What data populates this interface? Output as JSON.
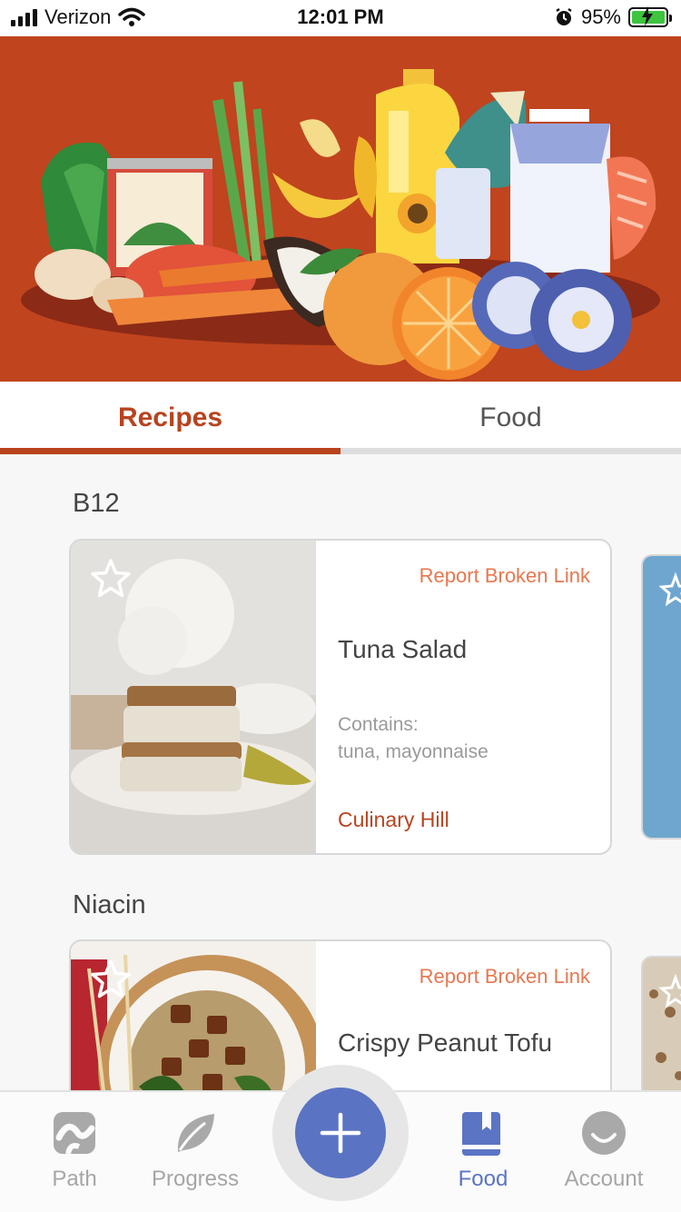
{
  "status_bar": {
    "carrier": "Verizon",
    "time": "12:01 PM",
    "battery": "95%"
  },
  "tabs": [
    {
      "label": "Recipes",
      "active": true
    },
    {
      "label": "Food",
      "active": false
    }
  ],
  "sections": [
    {
      "title": "B12",
      "card": {
        "report_label": "Report Broken Link",
        "name": "Tuna Salad",
        "contains_label": "Contains:",
        "contains": "tuna, mayonnaise",
        "source": "Culinary Hill"
      }
    },
    {
      "title": "Niacin",
      "card": {
        "report_label": "Report Broken Link",
        "name": "Crispy Peanut Tofu"
      }
    }
  ],
  "bottom_nav": {
    "path": "Path",
    "progress": "Progress",
    "food": "Food",
    "account": "Account",
    "active": "Food"
  },
  "colors": {
    "brand": "#b8431f",
    "hero_bg": "#c0441e",
    "accent_blue": "#5a73c3",
    "link_orange": "#e8774f"
  }
}
